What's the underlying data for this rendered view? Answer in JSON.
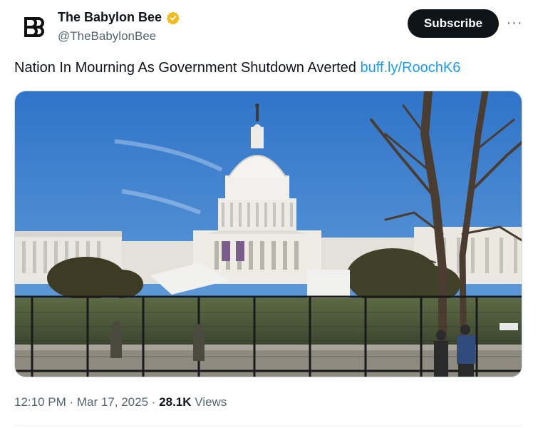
{
  "author": {
    "display_name": "The Babylon Bee",
    "handle": "@TheBabylonBee",
    "verified": true,
    "verified_color": "#f4b91b"
  },
  "actions": {
    "subscribe_label": "Subscribe",
    "more_label": "···"
  },
  "tweet": {
    "text": "Nation In Mourning As Government Shutdown Averted",
    "link": "buff.ly/RoochK6",
    "image_alt": "U.S. Capitol building behind security fencing under a blue sky"
  },
  "meta": {
    "time": "12:10 PM",
    "separator1": " · ",
    "date": "Mar 17, 2025",
    "separator2": " · ",
    "views_count": "28.1K",
    "views_label": " Views"
  },
  "colors": {
    "link": "#1d9bf0",
    "button_bg": "#0f1419",
    "secondary_text": "#536471"
  }
}
